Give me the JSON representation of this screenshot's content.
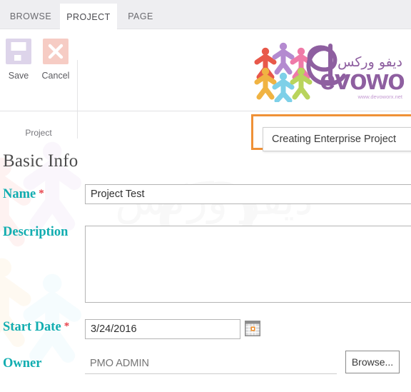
{
  "ribbon": {
    "tabs": [
      {
        "label": "BROWSE",
        "active": false
      },
      {
        "label": "PROJECT",
        "active": true
      },
      {
        "label": "PAGE",
        "active": false
      }
    ],
    "buttons": [
      {
        "label": "Save",
        "icon": "save-floppy-icon",
        "color": "#ddd4ea"
      },
      {
        "label": "Cancel",
        "icon": "cancel-x-icon",
        "color": "#f6ccc4"
      }
    ],
    "group_label": "Project"
  },
  "logo": {
    "wordmark": "evoworx",
    "arabic": "ديفو وركس",
    "url": "www.devoworx.net",
    "people_colors": [
      "#e8584a",
      "#b48ad0",
      "#ef7aa8",
      "#f0b342",
      "#7ed0e8",
      "#b9d45c"
    ],
    "wordmark_color": "#8e5fa0"
  },
  "callout": {
    "text": "Creating Enterprise Project",
    "frame_color": "#ef9137"
  },
  "form": {
    "title": "Basic Info",
    "accent_color": "#11adb0",
    "required_color": "#e8414a",
    "fields": {
      "name": {
        "label": "Name",
        "required": true,
        "required_mark": "*",
        "value": "Project Test",
        "placeholder": ""
      },
      "description": {
        "label": "Description",
        "required": false,
        "required_mark": "",
        "value": "",
        "placeholder": ""
      },
      "start_date": {
        "label": "Start Date",
        "required": true,
        "required_mark": "*",
        "value": "3/24/2016",
        "placeholder": "",
        "icon": "calendar-icon"
      },
      "owner": {
        "label": "Owner",
        "required": false,
        "required_mark": "",
        "value": "",
        "placeholder": "PMO ADMIN",
        "browse_label": "Browse..."
      }
    }
  }
}
